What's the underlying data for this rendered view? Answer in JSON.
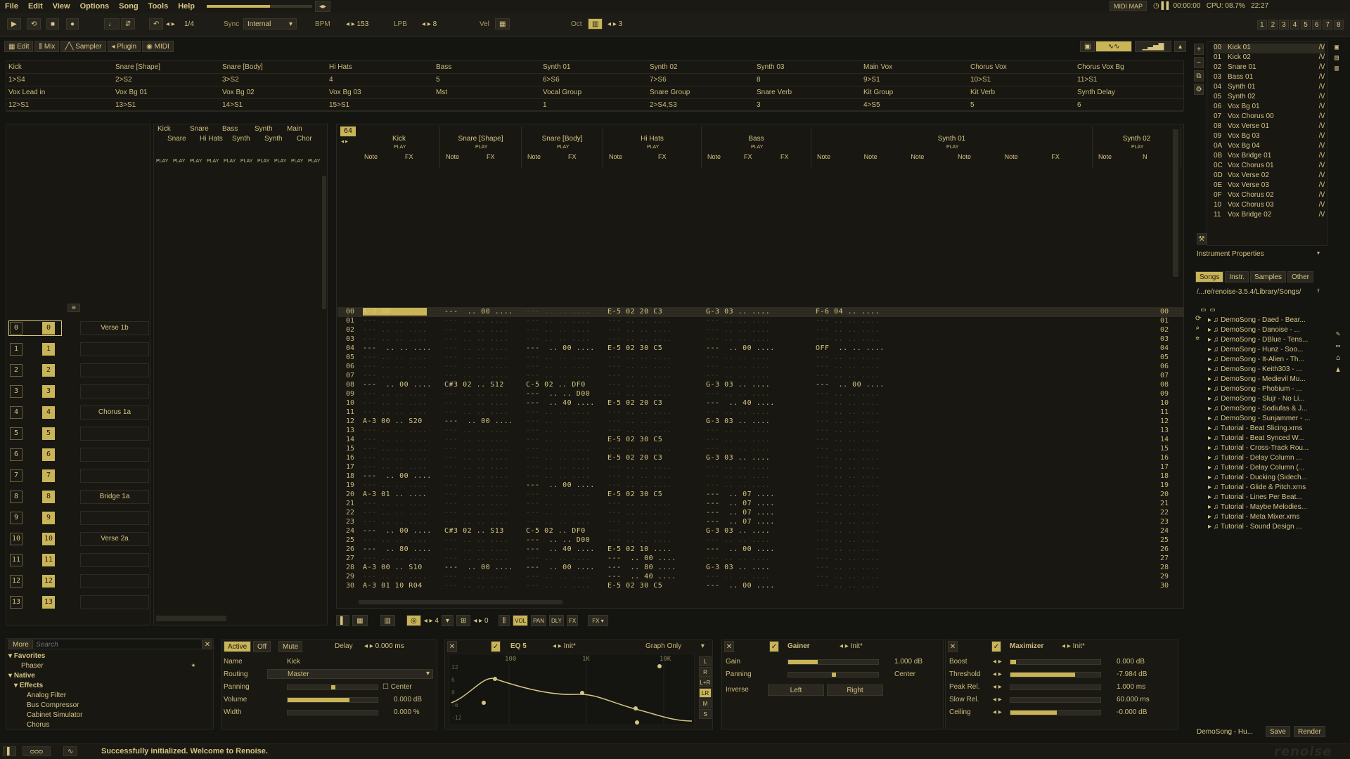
{
  "menu": [
    "File",
    "Edit",
    "View",
    "Options",
    "Song",
    "Tools",
    "Help"
  ],
  "topbar": {
    "midi_map": "MIDI MAP",
    "time": "00:00:00",
    "cpu": "CPU: 08.7%",
    "clock": "22:27",
    "pages": [
      "1",
      "2",
      "3",
      "4",
      "5",
      "6",
      "7",
      "8"
    ]
  },
  "transport": {
    "fraction": "1/4",
    "sync_label": "Sync",
    "sync_value": "Internal",
    "bpm_label": "BPM",
    "bpm": "153",
    "lpb_label": "LPB",
    "lpb": "8",
    "vel_label": "Vel",
    "oct_label": "Oct",
    "oct": "3"
  },
  "tabs": [
    "Edit",
    "Mix",
    "Sampler",
    "Plugin",
    "MIDI"
  ],
  "sends": {
    "names1": [
      "Kick",
      "Snare [Shape]",
      "Snare [Body]",
      "Hi Hats",
      "Bass",
      "Synth 01",
      "Synth 02",
      "Synth 03",
      "Main Vox",
      "Chorus Vox",
      "Chorus Vox Bg"
    ],
    "routes1": [
      "1>S4",
      "2>S2",
      "3>S2",
      "4",
      "5",
      "6>S6",
      "7>S6",
      "8",
      "9>S1",
      "10>S1",
      "11>S1"
    ],
    "names2": [
      "Vox Lead in",
      "Vox Bg 01",
      "Vox Bg 02",
      "Vox Bg 03",
      "Mst",
      "Vocal Group",
      "Snare Group",
      "Snare Verb",
      "Kit Group",
      "Kit Verb",
      "Synth Delay"
    ],
    "routes2": [
      "12>S1",
      "13>S1",
      "14>S1",
      "15>S1",
      "",
      "1",
      "2>S4,S3",
      "3",
      "4>S5",
      "5",
      "6"
    ]
  },
  "minimap": {
    "top": [
      "Kick",
      "Snare",
      "Bass",
      "Synth",
      "Main"
    ],
    "bottom": [
      "Snare",
      "Hi Hats",
      "Synth",
      "Synth",
      "Chor"
    ],
    "play": "PLAY"
  },
  "pattern": {
    "number": "64",
    "play": "PLAY",
    "tracks": [
      {
        "name": "Kick",
        "cols": [
          "Note",
          "FX"
        ]
      },
      {
        "name": "Snare [Shape]",
        "cols": [
          "Note",
          "FX"
        ]
      },
      {
        "name": "Snare [Body]",
        "cols": [
          "Note",
          "FX"
        ]
      },
      {
        "name": "Hi Hats",
        "cols": [
          "Note",
          "FX"
        ]
      },
      {
        "name": "Bass",
        "cols": [
          "Note",
          "FX",
          "FX"
        ]
      },
      {
        "name": "Synth 01",
        "cols": [
          "Note",
          "Note",
          "Note",
          "Note",
          "Note",
          "FX"
        ]
      },
      {
        "name": "Synth 02",
        "cols": [
          "Note",
          "N"
        ]
      }
    ],
    "rows": [
      "00",
      "01",
      "02",
      "03",
      "04",
      "05",
      "06",
      "07",
      "08",
      "09",
      "10",
      "11",
      "12",
      "13",
      "14",
      "15",
      "16",
      "17",
      "18",
      "19",
      "20",
      "21",
      "22",
      "23",
      "24",
      "25",
      "26",
      "27",
      "28",
      "29",
      "30"
    ],
    "cells": {
      "kick": {
        "0": "A-3 00 .. ....",
        "4": "---  .. .. ....",
        "8": "---  .. 00 ....",
        "12": "A-3 00 .. S20",
        "18": "---  .. 00 ....",
        "20": "A-3 01 .. ....",
        "24": "---  .. 00 ....",
        "26": "---  .. 80 ....",
        "28": "A-3 00 .. S10",
        "30": "A-3 01 10 R04"
      },
      "shape": {
        "0": "---  .. 00 ....",
        "8": "C#3 02 .. S12",
        "12": "---  .. 00 ....",
        "24": "C#3 02 .. S13",
        "28": "---  .. 00 ...."
      },
      "body": {
        "4": "---  .. 00 ....",
        "8": "C-5 02 .. DF0",
        "9": "---  .. .. D00",
        "10": "---  .. 40 ....",
        "19": "---  .. 00 ....",
        "24": "C-5 02 .. DF0",
        "25": "---  .. .. D00",
        "26": "---  .. 40 ....",
        "28": "---  .. 00 ...."
      },
      "hats": {
        "0": "E-5 02 20 C3",
        "4": "E-5 02 30 C5",
        "10": "E-5 02 20 C3",
        "14": "E-5 02 30 C5",
        "16": "E-5 02 20 C3",
        "20": "E-5 02 30 C5",
        "26": "E-5 02 10 ....",
        "27": "---  .. 00 ....",
        "28": "---  .. 80 ....",
        "29": "---  .. 40 ....",
        "30": "E-5 02 30 C5"
      },
      "bass": {
        "0": "G-3 03 .. ....",
        "4": "---  .. 00 ....",
        "8": "G-3 03 .. ....",
        "10": "---  .. 40 ....",
        "12": "G-3 03 .. ....",
        "16": "G-3 03 .. ....",
        "20": "---  .. 07 ....",
        "21": "---  .. 07 ....",
        "22": "---  .. 07 ....",
        "23": "---  .. 07 ....",
        "24": "G-3 03 .. ....",
        "26": "---  .. 00 ....",
        "28": "G-3 03 .. ....",
        "30": "---  .. 00 ...."
      },
      "synth": {
        "0": "F-6 04 .. ....",
        "4": "OFF  .. .. ....",
        "8": "---  .. 00 ...."
      }
    }
  },
  "sequencer": {
    "numbers": [
      "0",
      "1",
      "2",
      "3",
      "4",
      "5",
      "6",
      "7",
      "8",
      "9",
      "10",
      "11",
      "12",
      "13"
    ],
    "names": [
      "Verse 1b",
      "",
      "",
      "",
      "Chorus 1a",
      "",
      "",
      "",
      "Bridge 1a",
      "",
      "Verse 2a",
      "",
      "",
      ""
    ]
  },
  "instruments": [
    {
      "n": "00",
      "name": "Kick 01"
    },
    {
      "n": "01",
      "name": "Kick 02"
    },
    {
      "n": "02",
      "name": "Snare 01"
    },
    {
      "n": "03",
      "name": "Bass 01"
    },
    {
      "n": "04",
      "name": "Synth 01"
    },
    {
      "n": "05",
      "name": "Synth 02"
    },
    {
      "n": "06",
      "name": "Vox Bg 01"
    },
    {
      "n": "07",
      "name": "Vox Chorus 00"
    },
    {
      "n": "08",
      "name": "Vox Verse 01"
    },
    {
      "n": "09",
      "name": "Vox Bg 03"
    },
    {
      "n": "0A",
      "name": "Vox Bg 04"
    },
    {
      "n": "0B",
      "name": "Vox Bridge 01"
    },
    {
      "n": "0C",
      "name": "Vox Chorus 01"
    },
    {
      "n": "0D",
      "name": "Vox Verse 02"
    },
    {
      "n": "0E",
      "name": "Vox Verse 03"
    },
    {
      "n": "0F",
      "name": "Vox Chorus 02"
    },
    {
      "n": "10",
      "name": "Vox Chorus 03"
    },
    {
      "n": "11",
      "name": "Vox Bridge 02"
    }
  ],
  "inst_wave": "/\\/",
  "browser": {
    "props_label": "Instrument Properties",
    "tabs": [
      "Songs",
      "Instr.",
      "Samples",
      "Other"
    ],
    "path": "/...re/renoise-3.5.4/Library/Songs/",
    "songs": [
      "DemoSong - Daed - Bear...",
      "DemoSong - Danoise - ...",
      "DemoSong - DBlue - Tens...",
      "DemoSong - Hunz - Soo...",
      "DemoSong - It-Alien - Th...",
      "DemoSong - Keith303 - ...",
      "DemoSong - Medievil Mu...",
      "DemoSong - Phobium - ...",
      "DemoSong - Slujr - No Li...",
      "DemoSong - Sodiufas & J...",
      "DemoSong - Sunjammer - ...",
      "Tutorial - Beat Slicing.xrns",
      "Tutorial - Beat Synced W...",
      "Tutorial - Cross-Track Rou...",
      "Tutorial - Delay Column ...",
      "Tutorial - Delay Column (...",
      "Tutorial - Ducking (Sidech...",
      "Tutorial - Glide & Pitch.xrns",
      "Tutorial - Lines Per Beat...",
      "Tutorial - Maybe Melodies...",
      "Tutorial - Meta Mixer.xrns",
      "Tutorial - Sound Design ..."
    ],
    "current": "DemoSong - Hu...",
    "save": "Save",
    "render": "Render"
  },
  "pattern_toolbar": {
    "step": "4",
    "val": "0",
    "vol": "VOL",
    "pan": "PAN",
    "dly": "DLY",
    "fx": "FX"
  },
  "dsp_browser": {
    "more": "More",
    "search": "Search",
    "favorites": "Favorites",
    "phaser": "Phaser",
    "native": "Native",
    "effects": "Effects",
    "items": [
      "Analog Filter",
      "Bus Compressor",
      "Cabinet Simulator",
      "Chorus"
    ]
  },
  "track_dsp": {
    "active": "Active",
    "off": "Off",
    "mute": "Mute",
    "delay_label": "Delay",
    "delay": "0.000 ms",
    "name_label": "Name",
    "name": "Kick",
    "routing_label": "Routing",
    "routing": "Master",
    "panning_label": "Panning",
    "center": "Center",
    "volume_label": "Volume",
    "volume": "0.000 dB",
    "width_label": "Width",
    "width": "0.000 %"
  },
  "eq": {
    "title": "EQ 5",
    "preset": "Init*",
    "mode": "Graph Only",
    "freqs": [
      "100",
      "1K",
      "10K"
    ],
    "db_labels": [
      "12",
      "6",
      "0",
      "-6",
      "-12"
    ],
    "chan": [
      "L",
      "R",
      "L+R",
      "LR",
      "M",
      "S"
    ]
  },
  "gainer": {
    "title": "Gainer",
    "preset": "Init*",
    "gain_label": "Gain",
    "gain": "1.000 dB",
    "panning_label": "Panning",
    "panning": "Center",
    "inverse_label": "Inverse",
    "left": "Left",
    "right": "Right"
  },
  "maximizer": {
    "title": "Maximizer",
    "preset": "Init*",
    "boost_label": "Boost",
    "boost": "0.000 dB",
    "threshold_label": "Threshold",
    "threshold": "-7.984 dB",
    "peak_label": "Peak Rel.",
    "peak": "1.000 ms",
    "slow_label": "Slow Rel.",
    "slow": "60.000 ms",
    "ceiling_label": "Ceiling",
    "ceiling": "-0.000 dB"
  },
  "status": {
    "message": "Successfully initialized. Welcome to Renoise.",
    "logo": "renoise"
  }
}
